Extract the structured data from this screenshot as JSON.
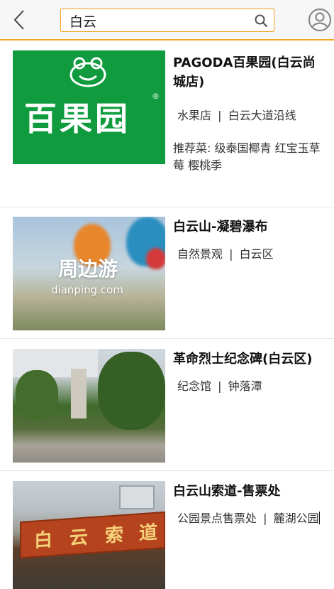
{
  "header": {
    "search": {
      "value": "白云",
      "placeholder": ""
    },
    "icons": {
      "back": "chevron-left-icon",
      "search": "search-icon",
      "user": "user-circle-icon"
    },
    "accent_color": "#f5a623"
  },
  "results": [
    {
      "title": "PAGODA百果园(白云尚城店)",
      "category": "水果店",
      "area": "白云大道沿线",
      "recommend_label": "推荐菜:",
      "recommend": "级泰国椰青   红宝玉草莓   樱桃季",
      "thumb": {
        "logo_text": "百果园"
      }
    },
    {
      "title": "白云山-凝碧瀑布",
      "category": "自然景观",
      "area": "白云区",
      "thumb": {
        "overlay_title": "周边游",
        "overlay_url": "dianping.com"
      }
    },
    {
      "title": "革命烈士纪念碑(白云区)",
      "category": "纪念馆",
      "area": "钟落潭"
    },
    {
      "title": "白云山索道-售票处",
      "category": "公园景点售票处",
      "area": "麓湖公园",
      "thumb": {
        "sign_text": [
          "白",
          "云",
          "索",
          "道"
        ]
      }
    }
  ],
  "separator": "|"
}
